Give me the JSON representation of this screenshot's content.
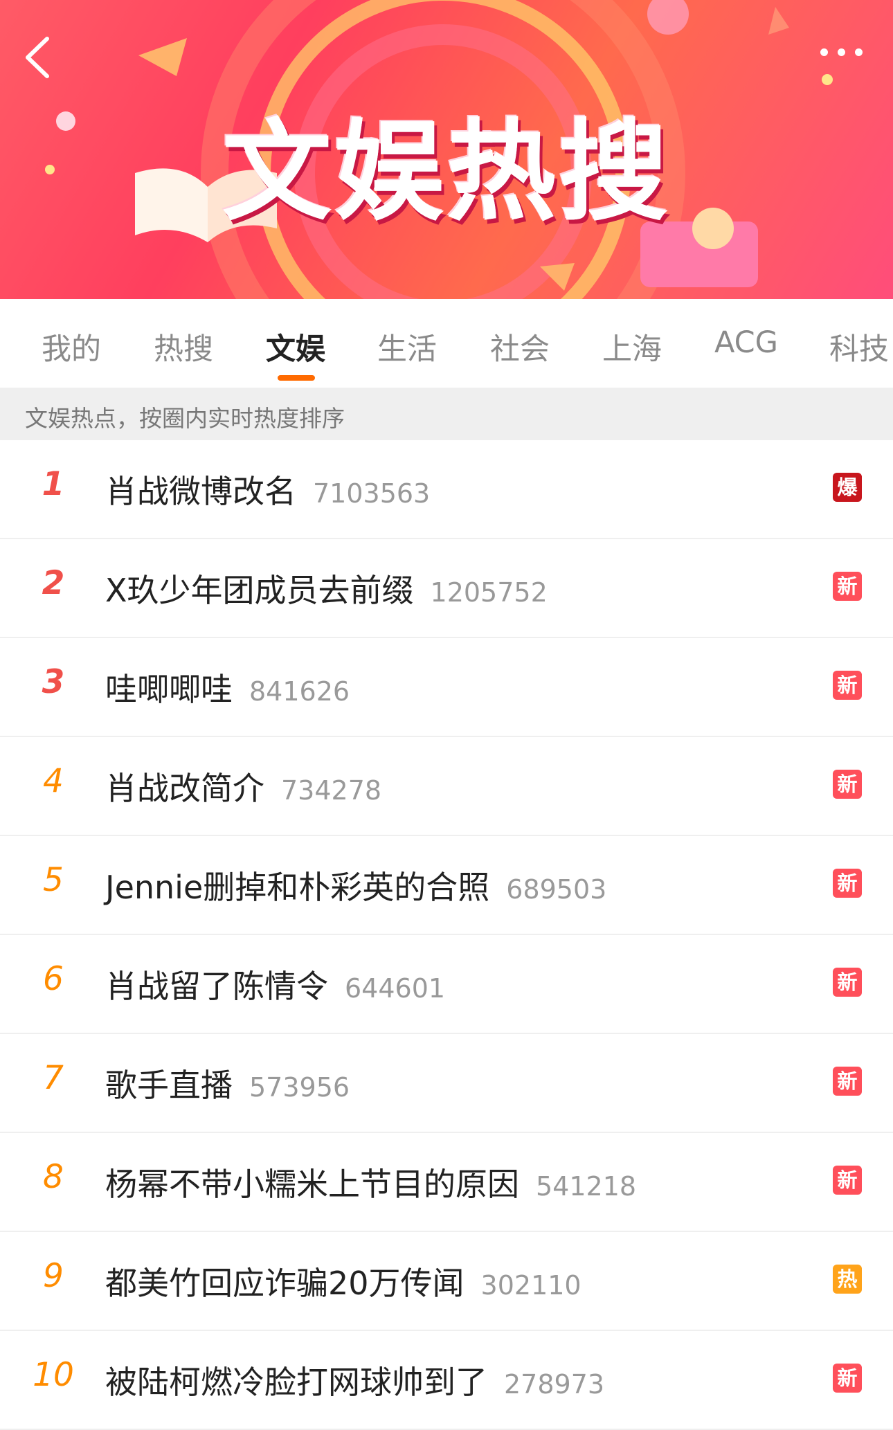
{
  "banner": {
    "title": "文娱热搜"
  },
  "tabs": [
    {
      "label": "我的"
    },
    {
      "label": "热搜"
    },
    {
      "label": "文娱"
    },
    {
      "label": "生活"
    },
    {
      "label": "社会"
    },
    {
      "label": "上海"
    },
    {
      "label": "ACG"
    },
    {
      "label": "科技"
    }
  ],
  "active_tab": "文娱",
  "notice": "文娱热点，按圈内实时热度排序",
  "items": [
    {
      "rank": "1",
      "title": "肖战微博改名",
      "count": "7103563",
      "badge": "爆"
    },
    {
      "rank": "2",
      "title": "X玖少年团成员去前缀",
      "count": "1205752",
      "badge": "新"
    },
    {
      "rank": "3",
      "title": "哇唧唧哇",
      "count": "841626",
      "badge": "新"
    },
    {
      "rank": "4",
      "title": "肖战改简介",
      "count": "734278",
      "badge": "新"
    },
    {
      "rank": "5",
      "title": "Jennie删掉和朴彩英的合照",
      "count": "689503",
      "badge": "新"
    },
    {
      "rank": "6",
      "title": "肖战留了陈情令",
      "count": "644601",
      "badge": "新"
    },
    {
      "rank": "7",
      "title": "歌手直播",
      "count": "573956",
      "badge": "新"
    },
    {
      "rank": "8",
      "title": "杨幂不带小糯米上节目的原因",
      "count": "541218",
      "badge": "新"
    },
    {
      "rank": "9",
      "title": "都美竹回应诈骗20万传闻",
      "count": "302110",
      "badge": "热"
    },
    {
      "rank": "10",
      "title": "被陆柯燃冷脸打网球帅到了",
      "count": "278973",
      "badge": "新"
    }
  ],
  "colors": {
    "rank_top3": "#f0504a",
    "rank_rest": "#ff8c00",
    "badge_boom": "#c8161d",
    "badge_new": "#ff4f5a",
    "badge_hot": "#ffa31a",
    "tab_underline": "#ff6a00"
  }
}
